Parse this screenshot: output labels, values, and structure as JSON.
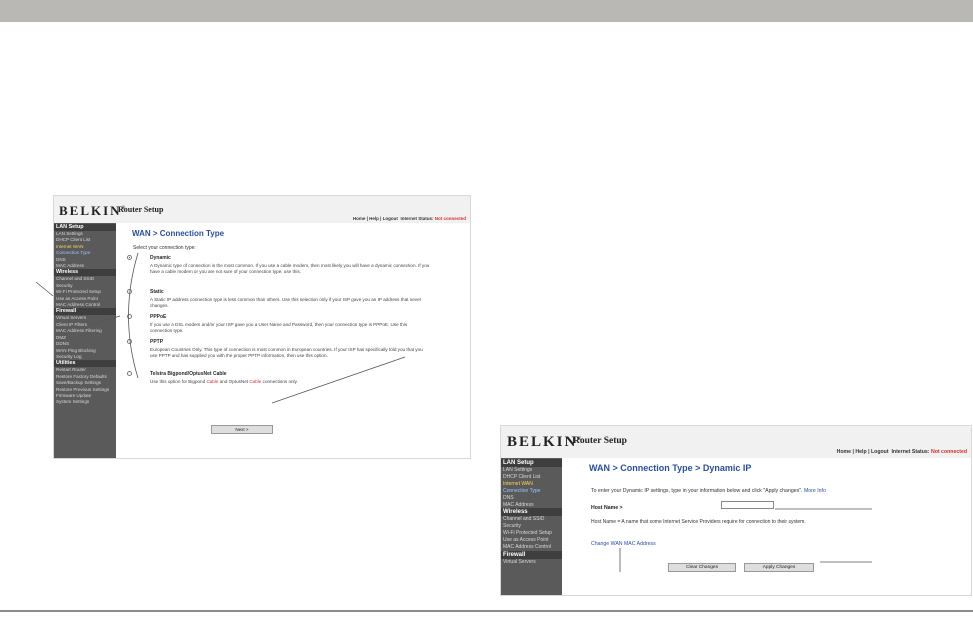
{
  "shot1": {
    "brand": "BELKIN",
    "app_title": "Router Setup",
    "topnav": {
      "home": "Home",
      "help": "Help",
      "logout": "Logout",
      "status_label": "Internet Status:",
      "status_value": "Not connected"
    },
    "sidebar": [
      {
        "type": "section",
        "label": "LAN Setup"
      },
      {
        "type": "item",
        "label": "LAN Settings"
      },
      {
        "type": "item",
        "label": "DHCP Client List"
      },
      {
        "type": "active",
        "label": "Internet WAN"
      },
      {
        "type": "current",
        "label": "Connection Type"
      },
      {
        "type": "item",
        "label": "DNS"
      },
      {
        "type": "item",
        "label": "MAC Address"
      },
      {
        "type": "section",
        "label": "Wireless"
      },
      {
        "type": "item",
        "label": "Channel and SSID"
      },
      {
        "type": "item",
        "label": "Security"
      },
      {
        "type": "item",
        "label": "Wi-Fi Protected Setup"
      },
      {
        "type": "item",
        "label": "Use as Access Point"
      },
      {
        "type": "item",
        "label": "MAC Address Control"
      },
      {
        "type": "section",
        "label": "Firewall"
      },
      {
        "type": "item",
        "label": "Virtual Servers"
      },
      {
        "type": "item",
        "label": "Client IP Filters"
      },
      {
        "type": "item",
        "label": "MAC Address Filtering"
      },
      {
        "type": "item",
        "label": "DMZ"
      },
      {
        "type": "item",
        "label": "DDNS"
      },
      {
        "type": "item",
        "label": "WAN Ping Blocking"
      },
      {
        "type": "item",
        "label": "Security Log"
      },
      {
        "type": "section",
        "label": "Utilities"
      },
      {
        "type": "item",
        "label": "Restart Router"
      },
      {
        "type": "item",
        "label": "Restore Factory Defaults"
      },
      {
        "type": "item",
        "label": "Save/Backup Settings"
      },
      {
        "type": "item",
        "label": "Restore Previous Settings"
      },
      {
        "type": "item",
        "label": "Firmware Update"
      },
      {
        "type": "item",
        "label": "System Settings"
      }
    ],
    "page_title": "WAN > Connection Type",
    "prompt": "Select your connection type:",
    "options": [
      {
        "name": "Dynamic",
        "selected": true,
        "desc": "A Dynamic type of connection is the most common. If you use a cable modem, then most likely you will have a dynamic connection. If you have a cable modem or you are not sure of your connection type, use this."
      },
      {
        "name": "Static",
        "selected": false,
        "desc": "A Static IP address connection type is less common than others. Use this selection only if your ISP gave you an IP address that never changes."
      },
      {
        "name": "PPPoE",
        "selected": false,
        "desc": "If you use a DSL modem and/or your ISP gave you a User Name and Password, then your connection type is PPPoE. Use this connection type."
      },
      {
        "name": "PPTP",
        "selected": false,
        "desc": "European Countries Only. This type of connection is most common in European countries. If your ISP has specifically told you that you use PPTP and has supplied you with the proper PPTP information, then use this option."
      },
      {
        "name": "Telstra Bigpond/OptusNet Cable",
        "selected": false,
        "desc_pre": "Use this option for Bigpond ",
        "desc_r1": "Cable",
        "desc_mid": " and OptusNet ",
        "desc_r2": "Cable",
        "desc_post": " connections only."
      }
    ],
    "next_button": "Next >"
  },
  "shot2": {
    "brand": "BELKIN",
    "app_title": "Router Setup",
    "topnav": {
      "home": "Home",
      "help": "Help",
      "logout": "Logout",
      "status_label": "Internet Status:",
      "status_value": "Not connected"
    },
    "sidebar": [
      {
        "type": "section",
        "label": "LAN Setup"
      },
      {
        "type": "item",
        "label": "LAN Settings"
      },
      {
        "type": "item",
        "label": "DHCP Client List"
      },
      {
        "type": "active",
        "label": "Internet WAN"
      },
      {
        "type": "current",
        "label": "Connection Type"
      },
      {
        "type": "item",
        "label": "DNS"
      },
      {
        "type": "item",
        "label": "MAC Address"
      },
      {
        "type": "section",
        "label": "Wireless"
      },
      {
        "type": "item",
        "label": "Channel and SSID"
      },
      {
        "type": "item",
        "label": "Security"
      },
      {
        "type": "item",
        "label": "Wi-Fi Protected Setup"
      },
      {
        "type": "item",
        "label": "Use as Access Point"
      },
      {
        "type": "item",
        "label": "MAC Address Control"
      },
      {
        "type": "section",
        "label": "Firewall"
      },
      {
        "type": "item",
        "label": "Virtual Servers"
      }
    ],
    "page_title": "WAN > Connection Type > Dynamic IP",
    "intro": "To enter your Dynamic IP settings, type in your information below and click \"Apply changes\".",
    "more_info": "More Info",
    "host_label": "Host Name >",
    "host_value": "",
    "host_desc": "Host Name = A name that some Internet Service Providers require for connection to their system.",
    "mac_link": "Change WAN MAC Address",
    "clear_button": "Clear Changes",
    "apply_button": "Apply Changes"
  }
}
